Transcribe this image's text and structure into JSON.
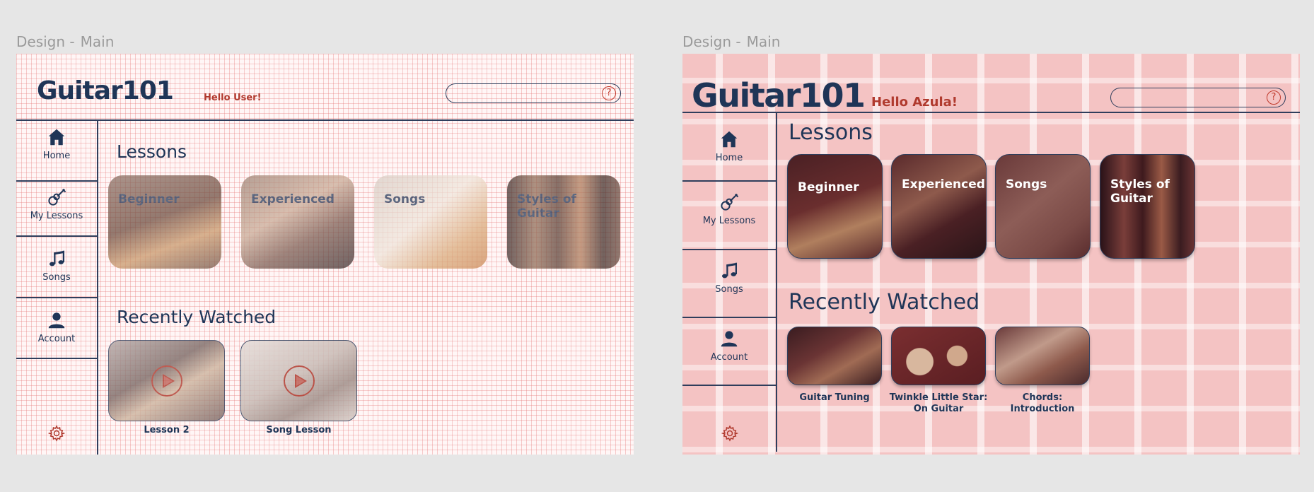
{
  "frames": [
    {
      "frame_label": {
        "prefix": "Design -",
        "name": "Main"
      },
      "logo": "Guitar101",
      "greeting": "Hello User!",
      "search": {
        "placeholder": "",
        "help_icon": "?"
      },
      "nav": [
        {
          "label": "Home",
          "icon": "home-icon"
        },
        {
          "label": "My Lessons",
          "icon": "guitar-icon"
        },
        {
          "label": "Songs",
          "icon": "music-note-icon"
        },
        {
          "label": "Account",
          "icon": "user-icon"
        }
      ],
      "lessons_title": "Lessons",
      "lessons": [
        {
          "label": "Beginner"
        },
        {
          "label": "Experienced"
        },
        {
          "label": "Songs"
        },
        {
          "label": "Styles of Guitar"
        }
      ],
      "recent_title": "Recently Watched",
      "recent": [
        {
          "caption": "Lesson 2"
        },
        {
          "caption": "Song Lesson"
        }
      ]
    },
    {
      "frame_label": {
        "prefix": "Design -",
        "name": "Main"
      },
      "logo": "Guitar101",
      "greeting": "Hello Azula!",
      "search": {
        "placeholder": "",
        "help_icon": "?"
      },
      "nav": [
        {
          "label": "Home",
          "icon": "home-icon"
        },
        {
          "label": "My Lessons",
          "icon": "guitar-icon"
        },
        {
          "label": "Songs",
          "icon": "music-note-icon"
        },
        {
          "label": "Account",
          "icon": "user-icon"
        }
      ],
      "lessons_title": "Lessons",
      "lessons": [
        {
          "label": "Beginner"
        },
        {
          "label": "Experienced"
        },
        {
          "label": "Songs"
        },
        {
          "label": "Styles of Guitar"
        }
      ],
      "recent_title": "Recently Watched",
      "recent": [
        {
          "caption": "Guitar Tuning"
        },
        {
          "caption": "Twinkle Little Star: On Guitar"
        },
        {
          "caption": "Chords: Introduction"
        }
      ]
    }
  ],
  "colors": {
    "navy": "#1f3557",
    "accent_red": "#b03a2e",
    "frame2_bg": "#f4c3c3"
  }
}
